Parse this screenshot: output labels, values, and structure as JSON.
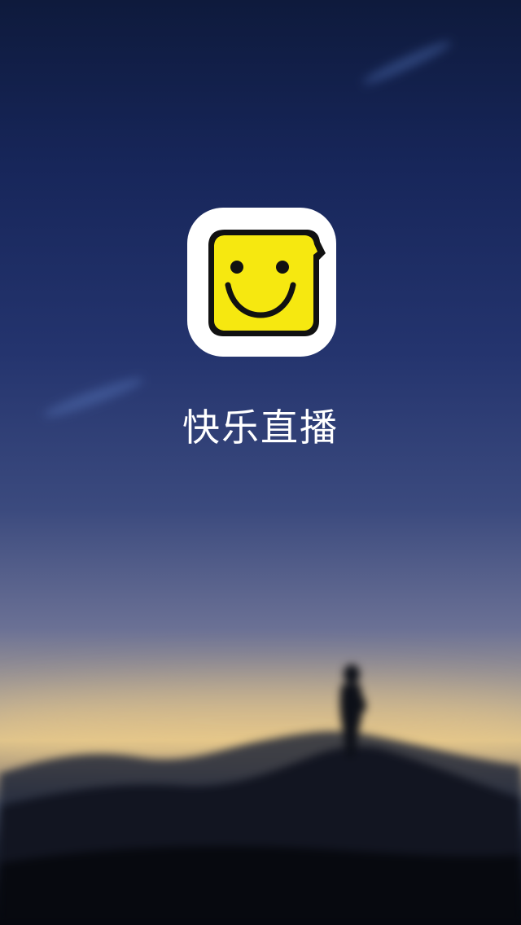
{
  "splash": {
    "app_name": "快乐直播",
    "logo_icon": "smiley-speech-bubble-icon",
    "colors": {
      "logo_yellow": "#f6e810",
      "logo_outline": "#111111",
      "logo_tile": "#ffffff",
      "app_name_text": "#ffffff",
      "sky_top": "#0e1a3c",
      "horizon_glow": "#dcc28d"
    }
  }
}
